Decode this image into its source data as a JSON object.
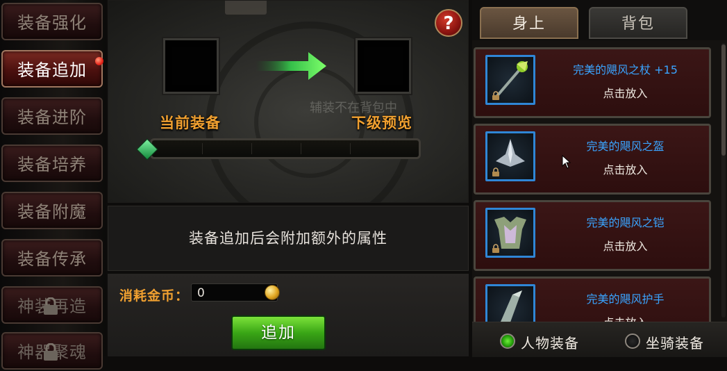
{
  "menu": {
    "items": [
      {
        "label": "装备强化",
        "state": "normal"
      },
      {
        "label": "装备追加",
        "state": "active",
        "badge": true
      },
      {
        "label": "装备进阶",
        "state": "normal"
      },
      {
        "label": "装备培养",
        "state": "normal"
      },
      {
        "label": "装备附魔",
        "state": "normal"
      },
      {
        "label": "装备传承",
        "state": "normal"
      },
      {
        "label": "神装再造",
        "state": "locked"
      },
      {
        "label": "神器聚魂",
        "state": "locked"
      }
    ]
  },
  "preview": {
    "help_label": "?",
    "current_label": "当前装备",
    "next_label": "下级预览",
    "ghost_text": "辅装不在背包中",
    "description": "装备追加后会附加额外的属性"
  },
  "cost": {
    "label": "消耗金币：",
    "value": "0",
    "action_label": "追加"
  },
  "inventory": {
    "tabs": [
      {
        "label": "身上",
        "active": true
      },
      {
        "label": "背包",
        "active": false
      }
    ],
    "items": [
      {
        "name": "完美的飓风之杖 +15",
        "action": "点击放入",
        "icon": "staff-icon"
      },
      {
        "name": "完美的飓风之盔",
        "action": "点击放入",
        "icon": "helmet-icon"
      },
      {
        "name": "完美的飓风之铠",
        "action": "点击放入",
        "icon": "armor-icon"
      },
      {
        "name": "完美的飓风护手",
        "action": "点击放入",
        "icon": "gauntlet-icon"
      }
    ],
    "filters": [
      {
        "label": "人物装备",
        "selected": true
      },
      {
        "label": "坐骑装备",
        "selected": false
      }
    ]
  },
  "colors": {
    "accent_orange": "#f0a030",
    "item_name_blue": "#3aa4ff",
    "confirm_green": "#3aa616"
  }
}
